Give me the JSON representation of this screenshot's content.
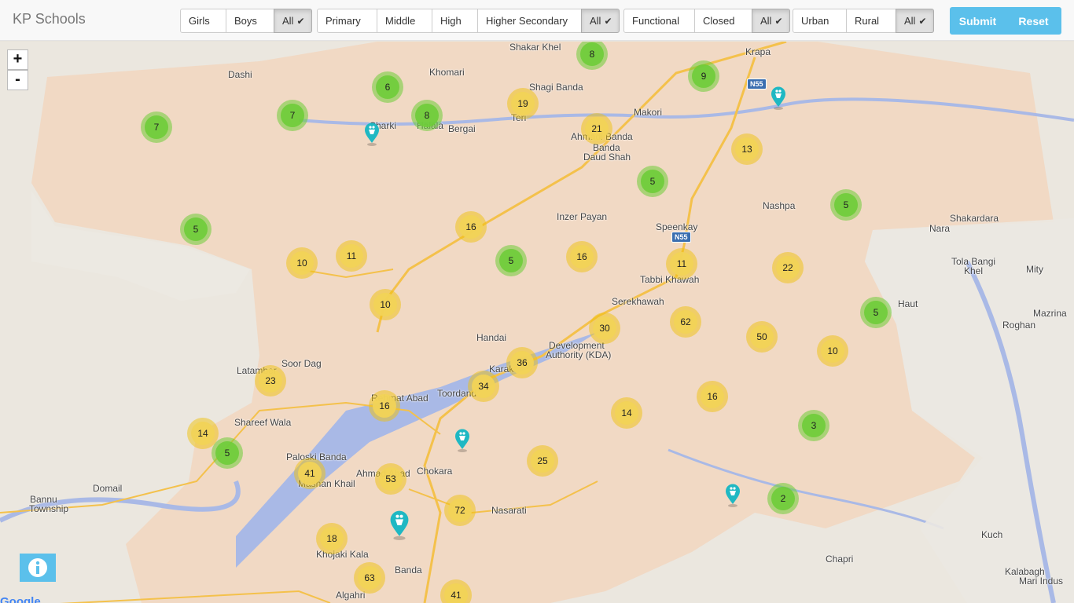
{
  "brand": "KP Schools",
  "filters": {
    "gender": [
      "Girls",
      "Boys",
      "All"
    ],
    "level": [
      "Primary",
      "Middle",
      "High",
      "Higher Secondary",
      "All"
    ],
    "status": [
      "Functional",
      "Closed",
      "All"
    ],
    "area": [
      "Urban",
      "Rural",
      "All"
    ]
  },
  "check_glyph": "✔",
  "actions": {
    "submit": "Submit",
    "reset": "Reset"
  },
  "zoom": {
    "in": "+",
    "out": "-"
  },
  "colors": {
    "green": "#6ecc39",
    "yellow": "#f1c40f",
    "accent": "#5bc0eb",
    "marker": "#1fb8c3"
  },
  "clusters": [
    {
      "n": "8",
      "c": "green"
    },
    {
      "n": "6",
      "c": "green"
    },
    {
      "n": "7",
      "c": "green"
    },
    {
      "n": "7",
      "c": "green"
    },
    {
      "n": "8",
      "c": "green"
    },
    {
      "n": "19",
      "c": "yellow"
    },
    {
      "n": "21",
      "c": "yellow"
    },
    {
      "n": "9",
      "c": "green"
    },
    {
      "n": "13",
      "c": "yellow"
    },
    {
      "n": "5",
      "c": "green"
    },
    {
      "n": "5",
      "c": "green"
    },
    {
      "n": "5",
      "c": "green"
    },
    {
      "n": "16",
      "c": "yellow"
    },
    {
      "n": "10",
      "c": "yellow"
    },
    {
      "n": "11",
      "c": "yellow"
    },
    {
      "n": "5",
      "c": "green"
    },
    {
      "n": "16",
      "c": "yellow"
    },
    {
      "n": "11",
      "c": "yellow"
    },
    {
      "n": "22",
      "c": "yellow"
    },
    {
      "n": "10",
      "c": "yellow"
    },
    {
      "n": "30",
      "c": "yellow"
    },
    {
      "n": "62",
      "c": "yellow"
    },
    {
      "n": "50",
      "c": "yellow"
    },
    {
      "n": "5",
      "c": "green"
    },
    {
      "n": "10",
      "c": "yellow"
    },
    {
      "n": "36",
      "c": "yellow"
    },
    {
      "n": "34",
      "c": "yellow"
    },
    {
      "n": "23",
      "c": "yellow"
    },
    {
      "n": "16",
      "c": "yellow"
    },
    {
      "n": "14",
      "c": "yellow"
    },
    {
      "n": "16",
      "c": "yellow"
    },
    {
      "n": "3",
      "c": "green"
    },
    {
      "n": "14",
      "c": "yellow"
    },
    {
      "n": "5",
      "c": "green"
    },
    {
      "n": "25",
      "c": "yellow"
    },
    {
      "n": "41",
      "c": "yellow"
    },
    {
      "n": "53",
      "c": "yellow"
    },
    {
      "n": "72",
      "c": "yellow"
    },
    {
      "n": "2",
      "c": "green"
    },
    {
      "n": "18",
      "c": "yellow"
    },
    {
      "n": "63",
      "c": "yellow"
    },
    {
      "n": "41",
      "c": "yellow"
    }
  ],
  "places": [
    "Dashi",
    "Khomari",
    "Shakar Khel",
    "Krapa",
    "Shagi Banda",
    "Makori",
    "Teri",
    "Ahmadi Banda",
    "Banda",
    "Daud Shah",
    "Bergai",
    "Sharki",
    "Halala",
    "Inzer Payan",
    "Nashpa",
    "Shakardara",
    "Nara",
    "Speenkay",
    "Tabbi Khawah",
    "Tola Bangi",
    "Khel",
    "Mity",
    "Haut",
    "Mazrina",
    "Roghan",
    "Serekhawah",
    "Handai",
    "Karak",
    "Development",
    "Authority (KDA)",
    "Soor Dag",
    "Latamber",
    "Toordand",
    "Rehmat Abad",
    "Shareef Wala",
    "Paloski Banda",
    "Mashan Khail",
    "Ahmad Abad",
    "Chokara",
    "Domail",
    "Bannu",
    "Township",
    "Khojaki Kala",
    "Banda",
    "Algahri",
    "Chapri",
    "Kuch",
    "Kalabagh",
    "Mari Indus",
    "Nasarati"
  ],
  "roads": [
    "N55",
    "N55"
  ],
  "google": "Google"
}
